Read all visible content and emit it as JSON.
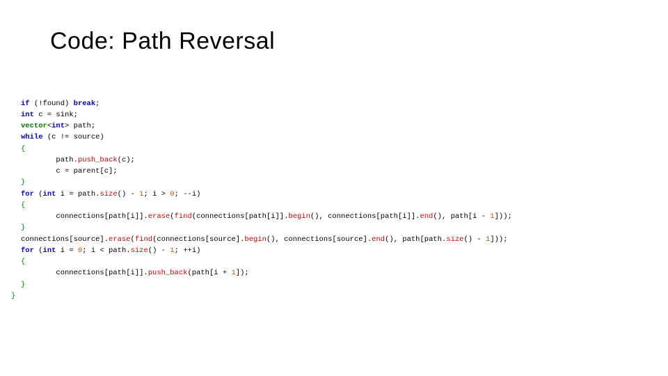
{
  "title": "Code: Path Reversal",
  "code": {
    "l1_kw_if": "if",
    "l1_op": "(!found)",
    "l1_kw_break": "break",
    "l1_semi": ";",
    "l2_kw_int": "int",
    "l2_rest": " c = sink;",
    "l3_type": "vector",
    "l3_lt": "<",
    "l3_int": "int",
    "l3_gt": ">",
    "l3_rest": " path;",
    "l4_kw_while": "while",
    "l4_cond": " (c != source)",
    "l5_br": "{",
    "l6a": "        path.",
    "l6_fn": "push_back",
    "l6b": "(c);",
    "l7": "        c = parent[c];",
    "l8_br": "}",
    "l9_kw_for": "for",
    "l9_a": " (",
    "l9_kw_int": "int",
    "l9_b": " i = path.",
    "l9_fn_size": "size",
    "l9_c": "() - ",
    "l9_n1": "1",
    "l9_d": "; i > ",
    "l9_n2": "0",
    "l9_e": "; --i)",
    "l10_br": "{",
    "l11_a": "        connections[path[i]].",
    "l11_fn_erase": "erase",
    "l11_b": "(",
    "l11_fn_find": "find",
    "l11_c": "(connections[path[i]].",
    "l11_fn_begin": "begin",
    "l11_d": "(), connections[path[i]].",
    "l11_fn_end": "end",
    "l11_e": "(), path[i - ",
    "l11_n1": "1",
    "l11_f": "]));",
    "l12_br": "}",
    "l13_a": "connections[source].",
    "l13_fn_erase": "erase",
    "l13_b": "(",
    "l13_fn_find": "find",
    "l13_c": "(connections[source].",
    "l13_fn_begin": "begin",
    "l13_d": "(), connections[source].",
    "l13_fn_end": "end",
    "l13_e": "(), path[path.",
    "l13_fn_size": "size",
    "l13_f": "() - ",
    "l13_n1": "1",
    "l13_g": "]));",
    "l14_kw_for": "for",
    "l14_a": " (",
    "l14_kw_int": "int",
    "l14_b": " i = ",
    "l14_n0": "0",
    "l14_c": "; i < path.",
    "l14_fn_size": "size",
    "l14_d": "() - ",
    "l14_n1": "1",
    "l14_e": "; ++i)",
    "l15_br": "{",
    "l16_a": "        connections[path[i]].",
    "l16_fn": "push_back",
    "l16_b": "(path[i + ",
    "l16_n1": "1",
    "l16_c": "]);",
    "l17_br": "}",
    "l18_br": "}"
  }
}
